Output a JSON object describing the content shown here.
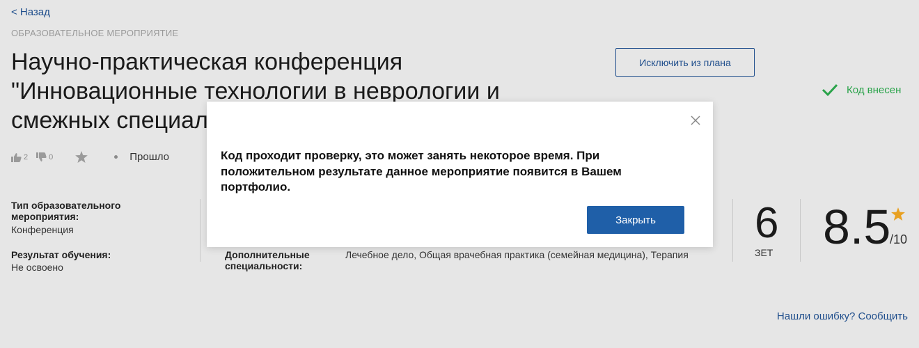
{
  "nav": {
    "back_label": "< Назад"
  },
  "event": {
    "category": "ОБРАЗОВАТЕЛЬНОЕ МЕРОПРИЯТИЕ",
    "title": "Научно-практическая конференция \"Инновационные технологии в неврологии и смежных специал"
  },
  "actions": {
    "exclude_label": "Исключить из плана"
  },
  "code_status": {
    "label": "Код внесен",
    "icon": "checkmark-icon",
    "color": "#2aa34a"
  },
  "feedback": {
    "likes": "2",
    "dislikes": "0",
    "status": "Прошло"
  },
  "details": {
    "type_label": "Тип образовательного мероприятия:",
    "type_value": "Конференция",
    "result_label": "Результат обучения:",
    "result_value": "Не освоено",
    "extra_specialties_label": "Дополнительные специальности:",
    "extra_specialties_value": "Лечебное дело, Общая врачебная практика (семейная медицина), Терапия"
  },
  "credits": {
    "value": "6",
    "unit": "ЗЕТ"
  },
  "rating": {
    "value": "8.5",
    "scale": "/10",
    "star_color": "#e8a020"
  },
  "report": {
    "label": "Нашли ошибку? Сообщить"
  },
  "modal": {
    "message": "Код проходит проверку, это может занять некоторое время. При положительном результате данное мероприятие появится в Вашем портфолио.",
    "close_label": "Закрыть"
  },
  "colors": {
    "accent": "#1f4e8c",
    "primary_button": "#1f5fa8",
    "success": "#2aa34a",
    "background": "#e6e6e6"
  }
}
